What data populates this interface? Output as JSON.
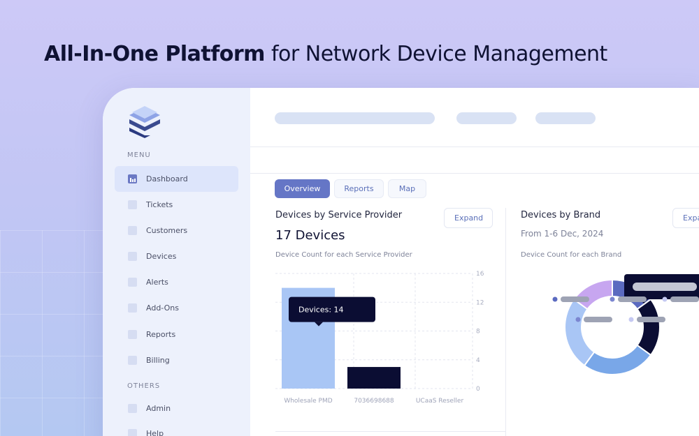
{
  "headline": {
    "bold": "All-In-One Platform",
    "rest": "for Network Device Management"
  },
  "sidebar": {
    "menu_heading": "MENU",
    "others_heading": "OTHERS",
    "items": [
      {
        "label": "Dashboard",
        "active": true
      },
      {
        "label": "Tickets"
      },
      {
        "label": "Customers"
      },
      {
        "label": "Devices"
      },
      {
        "label": "Alerts"
      },
      {
        "label": "Add-Ons"
      },
      {
        "label": "Reports"
      },
      {
        "label": "Billing"
      }
    ],
    "other_items": [
      {
        "label": "Admin"
      },
      {
        "label": "Help"
      }
    ]
  },
  "tabs": [
    "Overview",
    "Reports",
    "Map"
  ],
  "provider_card": {
    "title": "Devices by Service Provider",
    "count": "17 Devices",
    "subtitle": "Device Count for each Service Provider",
    "expand": "Expand",
    "tooltip": "Devices: 14"
  },
  "brand_card": {
    "title": "Devices by Brand",
    "date": "From 1-6 Dec, 2024",
    "subtitle": "Device Count for each Brand",
    "expand": "Expand"
  },
  "chart_data": [
    {
      "type": "bar",
      "categories": [
        "Wholesale PMD",
        "7036698688",
        "UCaaS Reseller"
      ],
      "values": [
        14,
        3,
        0
      ],
      "yticks": [
        "16",
        "12",
        "8",
        "4",
        "0"
      ],
      "ylim": [
        0,
        16
      ],
      "colors": [
        "#a9c6f5",
        "#0b0d33",
        "#a9c6f5"
      ],
      "grid": true
    },
    {
      "type": "pie",
      "values": [
        3,
        4,
        5,
        5,
        3
      ],
      "colors": [
        "#5b6ac0",
        "#0b0d33",
        "#79a7e8",
        "#a9c6f5",
        "#c7a6f0"
      ],
      "legend_colors": [
        "#5b6ac0",
        "#7b86d0",
        "#c5c9f2",
        "#7b86d0",
        "#c5c9f2"
      ]
    }
  ]
}
